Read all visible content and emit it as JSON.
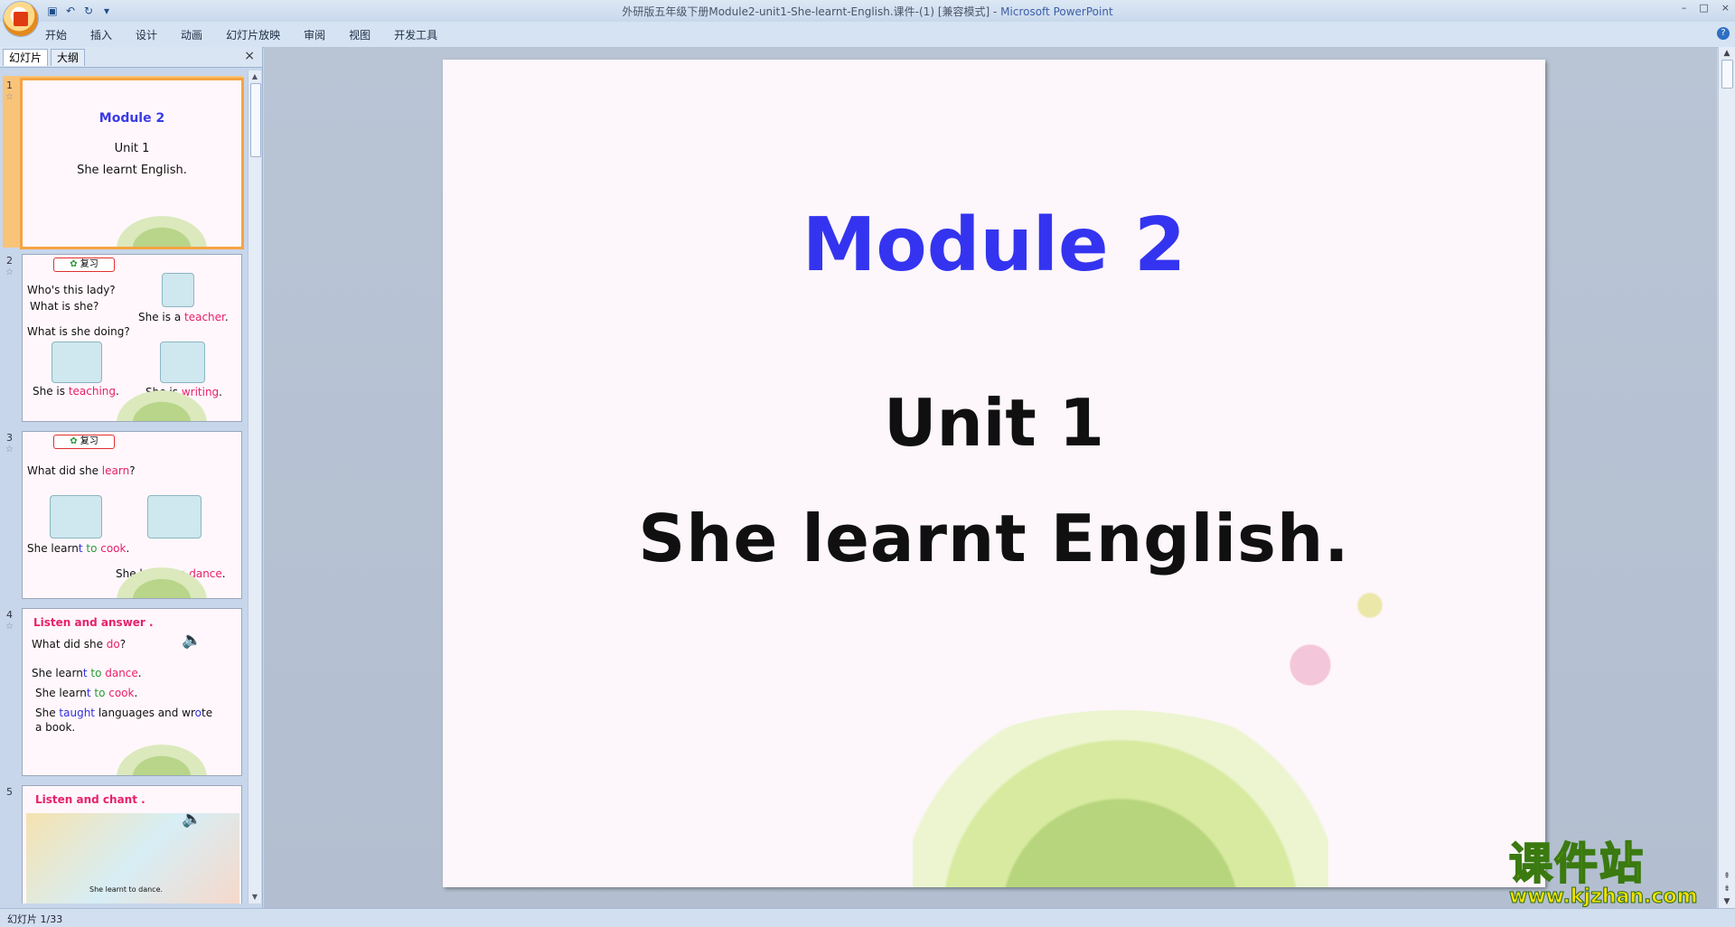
{
  "window": {
    "title": "外研版五年级下册Module2-unit1-She-learnt-English.课件-(1) [兼容模式]",
    "app_name": "Microsoft PowerPoint",
    "app_separator": " - "
  },
  "quick_access": {
    "save": "save-icon",
    "undo": "undo-icon",
    "redo": "redo-icon",
    "customize": "▾"
  },
  "window_controls": [
    "–",
    "□",
    "×"
  ],
  "ribbon_tabs": [
    "开始",
    "插入",
    "设计",
    "动画",
    "幻灯片放映",
    "审阅",
    "视图",
    "开发工具"
  ],
  "help_glyph": "?",
  "pane": {
    "tabs": [
      "幻灯片",
      "大纲"
    ],
    "close": "×"
  },
  "thumbnails": [
    {
      "number": "1",
      "module": "Module 2",
      "unit": "Unit 1",
      "subtitle": "She learnt English."
    },
    {
      "number": "2",
      "badge": "复习",
      "q1": "Who's this lady?",
      "q2": "What is she?",
      "a1_pre": "She is a ",
      "a1_key": "teacher",
      "a1_post": ".",
      "q3": "What is she doing?",
      "a2_pre": "She is ",
      "a2_key": "teaching",
      "a2_post": ".",
      "a3_pre": "She is ",
      "a3_key": "writing",
      "a3_post": "."
    },
    {
      "number": "3",
      "badge": "复习",
      "q1_pre": "What did she ",
      "q1_key": "learn",
      "q1_post": "?",
      "a1_pre": "She learn",
      "a1_t": "t",
      "a1_to": " to ",
      "a1_key": "cook",
      "a1_post": ".",
      "a2_pre": "She learn",
      "a2_t": "t",
      "a2_to": " to ",
      "a2_key": "dance",
      "a2_post": "."
    },
    {
      "number": "4",
      "heading": "Listen and answer  .",
      "q_pre": "What did she ",
      "q_key": "do",
      "q_post": "?",
      "l1_pre": "She learn",
      "l1_t": "t",
      "l1_to": " to ",
      "l1_key": "dance",
      "l1_post": ".",
      "l2_pre": "She learn",
      "l2_t": "t",
      "l2_to": " to ",
      "l2_key": "cook",
      "l2_post": ".",
      "l3_pre": "She ",
      "l3_key": "taught",
      "l3_mid": " languages and wr",
      "l3_o": "o",
      "l3_post": "te",
      "l4": "a book."
    },
    {
      "number": "5",
      "heading": "Listen and chant .",
      "caption": "She learnt to dance."
    }
  ],
  "slide": {
    "title": "Module 2",
    "unit": "Unit 1",
    "subtitle": "She learnt English.",
    "title_color": "#3434f0"
  },
  "watermark": {
    "cn": "课件站",
    "url": "www.kjzhan.com"
  },
  "status": {
    "text": "幻灯片 1/33"
  }
}
